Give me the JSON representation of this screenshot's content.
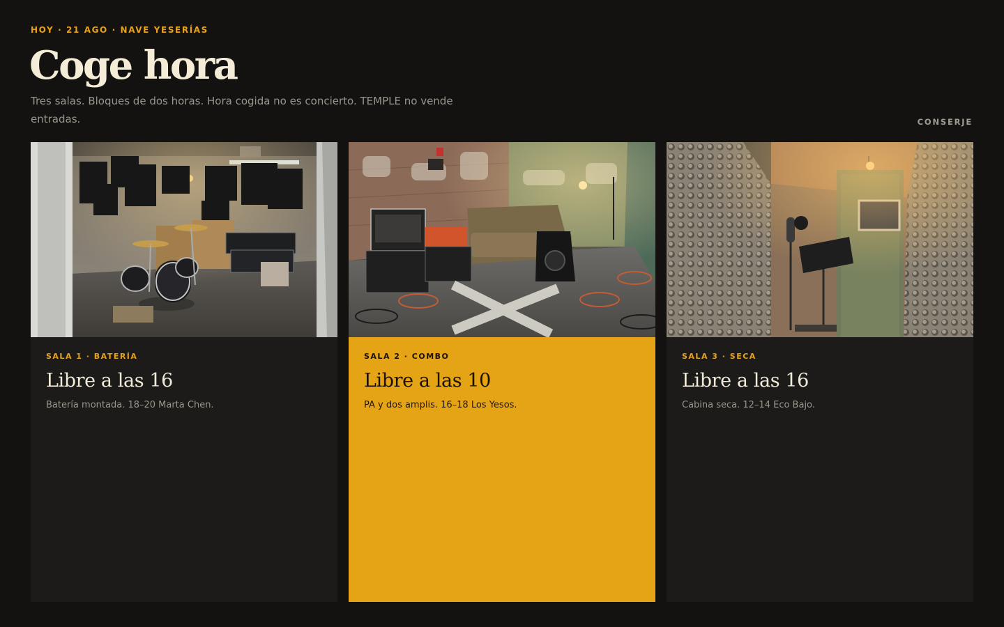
{
  "header": {
    "eyebrow": "HOY · 21 AGO · NAVE YESERÍAS",
    "title": "Coge hora",
    "subtitle": "Tres salas. Bloques de dos horas. Hora cogida no es concierto. TEMPLE no vende entradas.",
    "concierge_label": "CONSERJE"
  },
  "colors": {
    "background": "#131211",
    "card": "#1c1b19",
    "accent": "#e5a316",
    "title": "#f5ecd7",
    "muted": "#9b968d"
  },
  "rooms": [
    {
      "tag": "SALA 1 · BATERÍA",
      "status": "Libre a las 16",
      "note": "Batería montada. 18–20 Marta Chen.",
      "photo": "drum-room-photo",
      "selected": false
    },
    {
      "tag": "SALA 2 · COMBO",
      "status": "Libre a las 10",
      "note": "PA y dos amplis. 16–18 Los Yesos.",
      "photo": "combo-room-photo",
      "selected": true
    },
    {
      "tag": "SALA 3 · SECA",
      "status": "Libre a las 16",
      "note": "Cabina seca. 12–14 Eco Bajo.",
      "photo": "dry-booth-photo",
      "selected": false
    }
  ]
}
